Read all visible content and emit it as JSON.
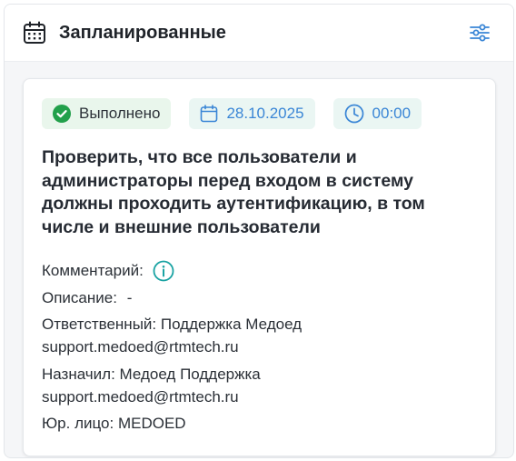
{
  "header": {
    "title": "Запланированные",
    "icon": "calendar-icon",
    "filter_icon": "sliders-icon"
  },
  "card": {
    "status": {
      "label": "Выполнено",
      "icon": "check-circle-icon",
      "color": "#22a04b"
    },
    "date": {
      "value": "28.10.2025",
      "icon": "calendar-icon"
    },
    "time": {
      "value": "00:00",
      "icon": "clock-icon"
    },
    "title": "Проверить, что все пользователи и администраторы перед входом в систему должны проходить аутентификацию, в том числе и внешние пользователи",
    "comment_label": "Комментарий:",
    "description_label": "Описание:",
    "description_value": "-",
    "responsible_label": "Ответственный:",
    "responsible_name": "Поддержка Медоед",
    "responsible_email": "support.medoed@rtmtech.ru",
    "assigned_label": "Назначил:",
    "assigned_name": "Медоед Поддержка",
    "assigned_email": "support.medoed@rtmtech.ru",
    "legal_label": "Юр. лицо:",
    "legal_value": "MEDOED"
  },
  "colors": {
    "accent_blue": "#3a86d6",
    "info_teal": "#1aa3a3",
    "status_green": "#22a04b"
  }
}
